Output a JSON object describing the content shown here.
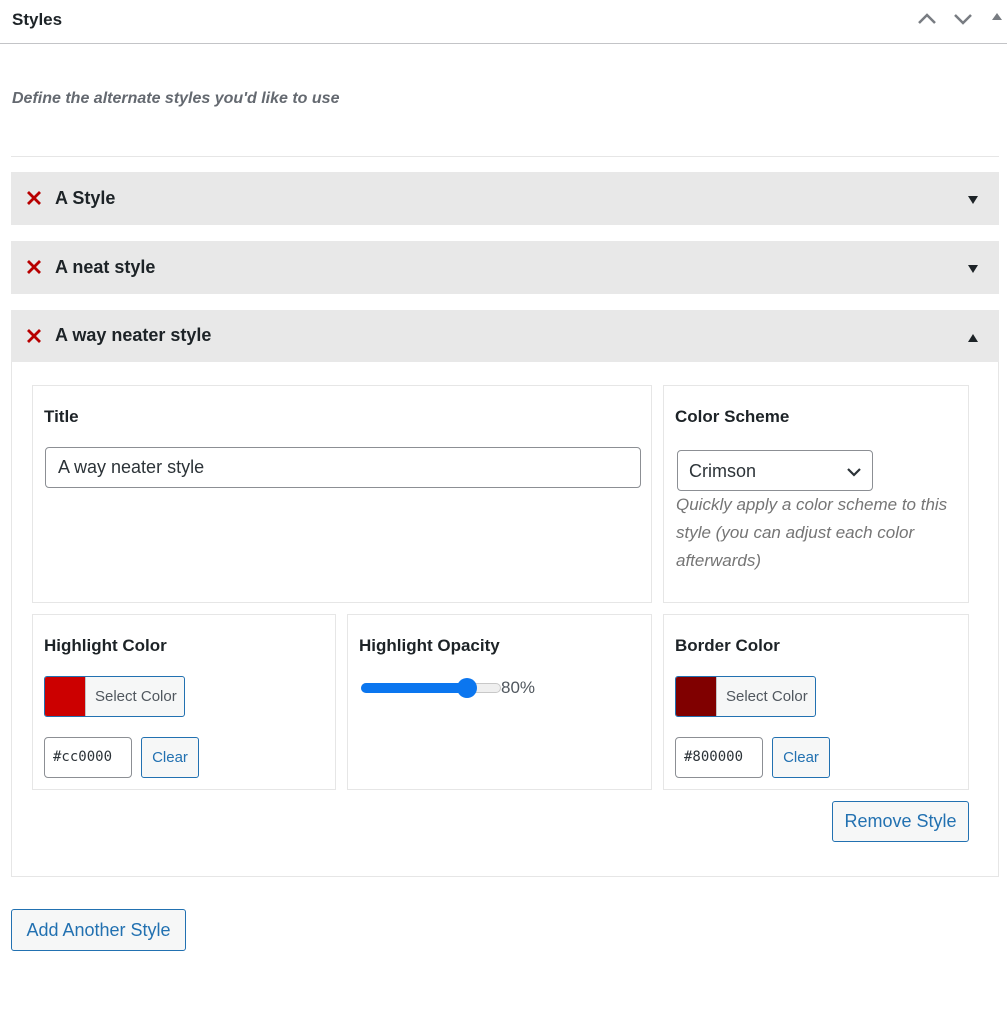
{
  "panel": {
    "title": "Styles",
    "controls": [
      "move-up",
      "move-down",
      "toggle-panel"
    ]
  },
  "description": "Define the alternate styles you'd like to use",
  "styles": [
    {
      "title": "A Style",
      "expanded": false
    },
    {
      "title": "A neat style",
      "expanded": false
    },
    {
      "title": "A way neater style",
      "expanded": true
    }
  ],
  "editor": {
    "title_label": "Title",
    "title_value": "A way neater style",
    "color_scheme_label": "Color Scheme",
    "color_scheme_value": "Crimson",
    "color_scheme_help": "Quickly apply a color scheme to this style (you can adjust each color afterwards)",
    "highlight_color": {
      "label": "Highlight Color",
      "select_label": "Select Color",
      "value": "#cc0000",
      "swatch": "#cc0000",
      "clear_label": "Clear"
    },
    "highlight_opacity": {
      "label": "Highlight Opacity",
      "value": 80,
      "display": "80%"
    },
    "border_color": {
      "label": "Border Color",
      "select_label": "Select Color",
      "value": "#800000",
      "swatch": "#800000",
      "clear_label": "Clear"
    },
    "remove_label": "Remove Style"
  },
  "add_label": "Add Another Style",
  "colors": {
    "accent": "#2271b1",
    "remove_icon": "#b80000",
    "accordion_bg": "#e8e8e8",
    "slider": "#0b76ef"
  }
}
